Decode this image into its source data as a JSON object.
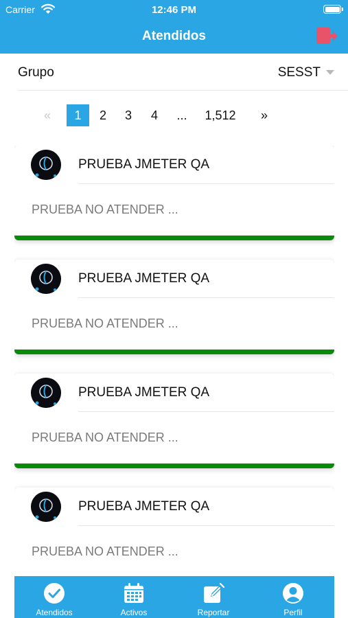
{
  "status_bar": {
    "carrier": "Carrier",
    "time": "12:46 PM"
  },
  "header": {
    "title": "Atendidos",
    "logout_icon": "logout-icon"
  },
  "filter": {
    "label": "Grupo",
    "selected": "SESST"
  },
  "pagination": {
    "prev": "«",
    "pages": [
      "1",
      "2",
      "3",
      "4"
    ],
    "ellipsis": "...",
    "last": "1,512",
    "next": "»",
    "active_page": "1"
  },
  "tickets": [
    {
      "title": "PRUEBA JMETER QA",
      "description": "PRUEBA NO ATENDER ...",
      "status_color": "#0a8a0a"
    },
    {
      "title": "PRUEBA JMETER QA",
      "description": "PRUEBA NO ATENDER ...",
      "status_color": "#0a8a0a"
    },
    {
      "title": "PRUEBA JMETER QA",
      "description": "PRUEBA NO ATENDER ...",
      "status_color": "#0a8a0a"
    },
    {
      "title": "PRUEBA JMETER QA",
      "description": "PRUEBA NO ATENDER ..."
    }
  ],
  "tabs": [
    {
      "label": "Atendidos",
      "icon": "check-circle-icon",
      "active": true
    },
    {
      "label": "Activos",
      "icon": "calendar-icon"
    },
    {
      "label": "Reportar",
      "icon": "edit-icon"
    },
    {
      "label": "Perfil",
      "icon": "user-icon"
    }
  ],
  "colors": {
    "primary": "#2aa6e4",
    "status_done": "#0a8a0a",
    "logout": "#e8536a"
  }
}
